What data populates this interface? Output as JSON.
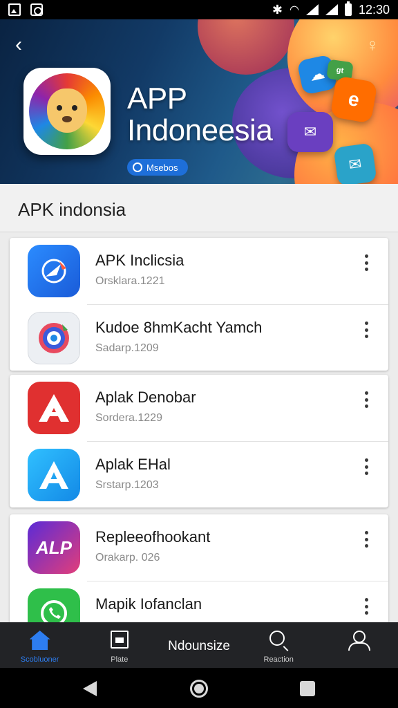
{
  "status_bar": {
    "time": "12:30"
  },
  "header": {
    "title_line1": "APP",
    "title_line2": "Indoneesia",
    "badge": "Msebos"
  },
  "section": {
    "title": "APK indonsia"
  },
  "apps": [
    {
      "title": "APK Inclicsia",
      "subtitle": "Orsklara.1221",
      "icon": "arrow-app-icon"
    },
    {
      "title": "Kudoe 8hmKacht Yamch",
      "subtitle": "Sadarp.1209",
      "icon": "target-app-icon"
    },
    {
      "title": "Aplak Denobar",
      "subtitle": "Sordera.1229",
      "icon": "red-a-app-icon"
    },
    {
      "title": "Aplak EHal",
      "subtitle": "Srstarp.1203",
      "icon": "blue-a-app-icon"
    },
    {
      "title": "Repleeofhookant",
      "subtitle": "Orakarp. 026",
      "icon_text": "ALP",
      "icon": "alp-app-icon"
    },
    {
      "title": "Mapik Iofanclan",
      "subtitle": "",
      "icon": "whatsapp-app-icon"
    }
  ],
  "bottom_nav": [
    {
      "label": "Scobluoner",
      "icon": "home-icon",
      "active": true
    },
    {
      "label": "Plate",
      "icon": "page-icon",
      "active": false
    },
    {
      "label": "Ndounsize",
      "icon": "",
      "active": false
    },
    {
      "label": "Reaction",
      "icon": "search-icon",
      "active": false
    },
    {
      "label": "",
      "icon": "profile-icon",
      "active": false
    }
  ],
  "colors": {
    "accent": "#2d7df0",
    "banner_dark": "#0a2342",
    "nav_bg": "#222326"
  }
}
